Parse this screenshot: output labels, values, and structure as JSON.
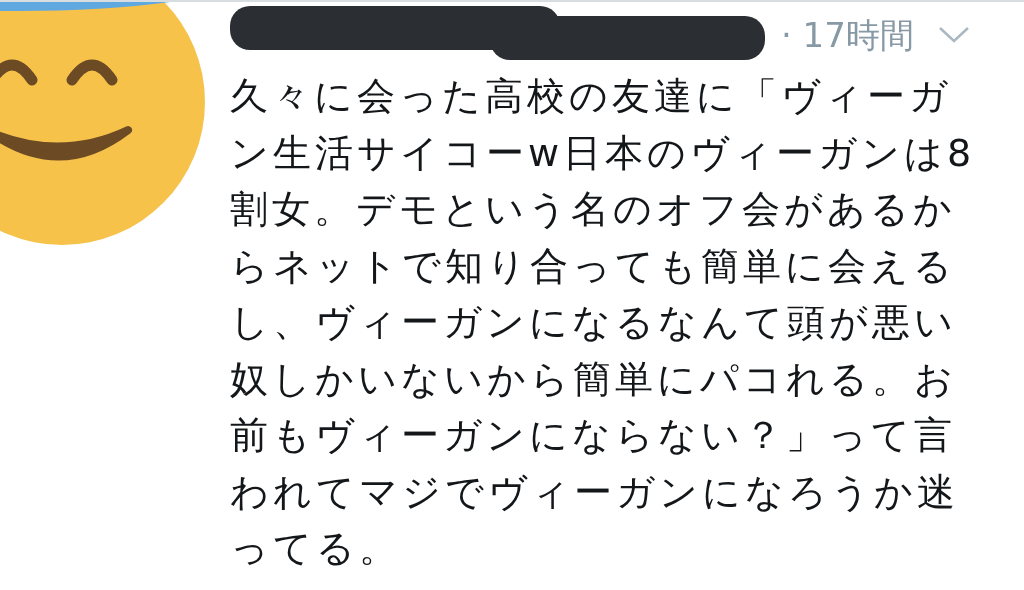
{
  "tweet": {
    "time": "· 17時間",
    "lines": [
      "久々に会った高校の友達に「ヴィーガ",
      "ン生活サイコーw日本のヴィーガンは8",
      "割女。デモという名のオフ会があるか",
      "らネットで知り合っても簡単に会える",
      "し、ヴィーガンになるなんて頭が悪い",
      "奴しかいないから簡単にパコれる。お",
      "前もヴィーガンにならない？」って言",
      "われてマジでヴィーガンになろうか迷",
      "ってる。"
    ]
  }
}
